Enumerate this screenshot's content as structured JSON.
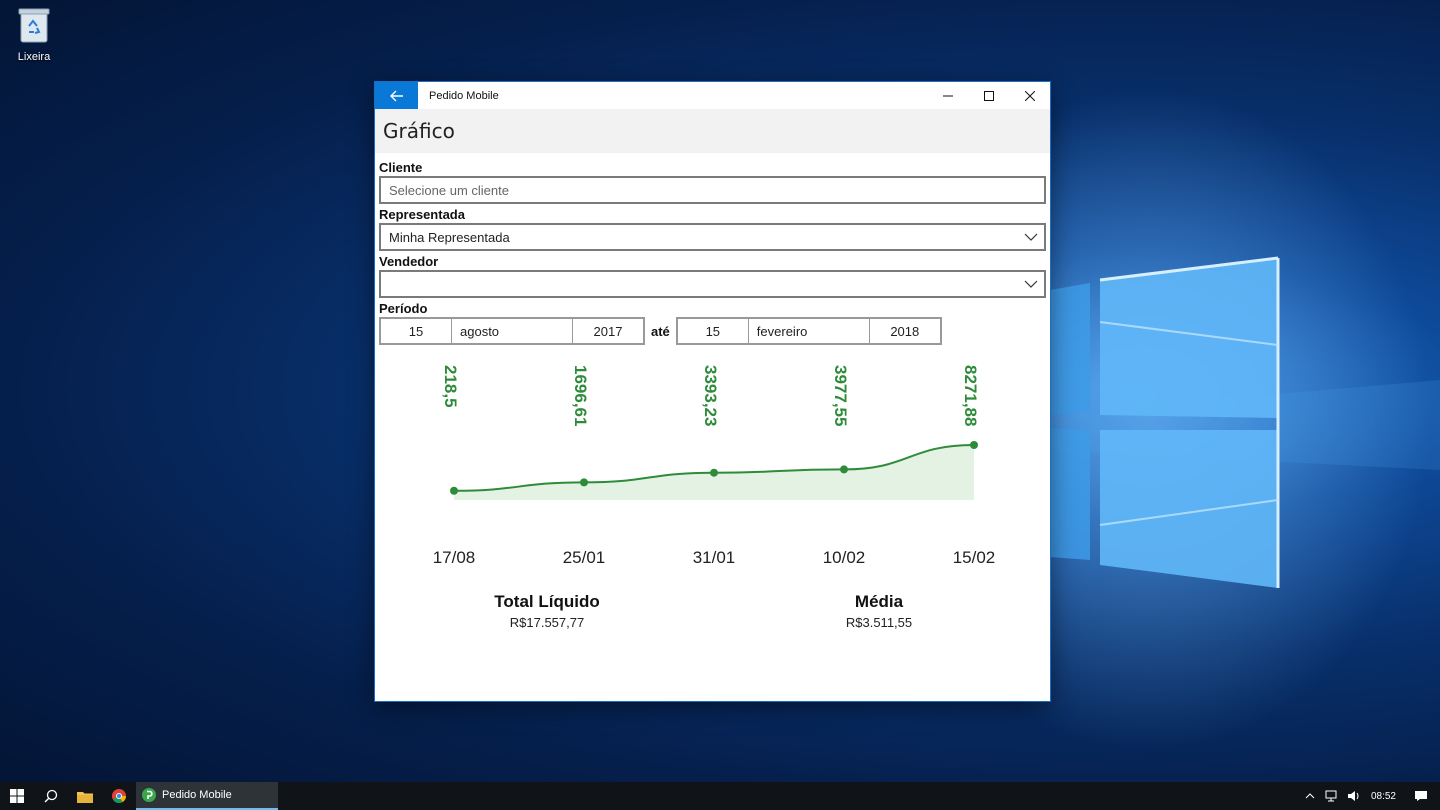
{
  "desktop": {
    "recycle_bin_label": "Lixeira"
  },
  "window": {
    "title": "Pedido Mobile",
    "page_title": "Gráfico"
  },
  "form": {
    "cliente_label": "Cliente",
    "cliente_placeholder": "Selecione um cliente",
    "representada_label": "Representada",
    "representada_value": "Minha Representada",
    "vendedor_label": "Vendedor",
    "vendedor_value": "",
    "periodo_label": "Período",
    "start_date": {
      "day": "15",
      "month": "agosto",
      "year": "2017"
    },
    "ate_label": "até",
    "end_date": {
      "day": "15",
      "month": "fevereiro",
      "year": "2018"
    }
  },
  "chart_data": {
    "type": "area",
    "categories": [
      "17/08",
      "25/01",
      "31/01",
      "10/02",
      "15/02"
    ],
    "values": [
      218.5,
      1696.61,
      3393.23,
      3977.55,
      8271.88
    ],
    "value_labels": [
      "218,5",
      "1696,61",
      "3393,23",
      "3977,55",
      "8271,88"
    ],
    "color": "#2e8b3a",
    "fill": "#e4f2e4"
  },
  "summary": {
    "total_label": "Total Líquido",
    "total_value": "R$17.557,77",
    "media_label": "Média",
    "media_value": "R$3.511,55"
  },
  "taskbar": {
    "app_label": "Pedido Mobile",
    "clock": "08:52"
  }
}
